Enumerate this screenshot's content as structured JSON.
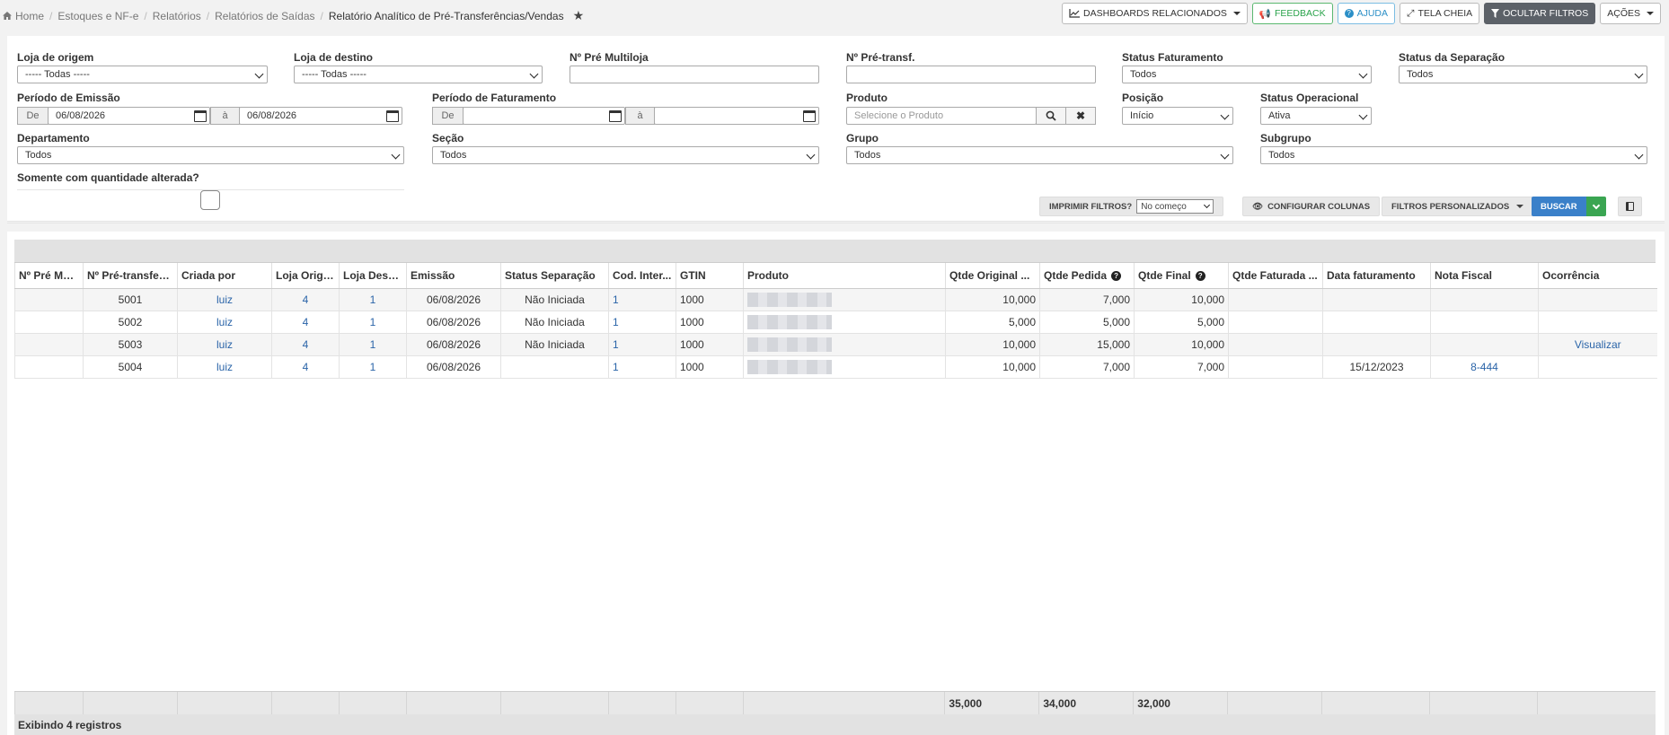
{
  "breadcrumb": {
    "items": [
      "Home",
      "Estoques e NF-e",
      "Relatórios",
      "Relatórios de Saídas"
    ],
    "current": "Relatório Analítico de Pré-Transferências/Vendas"
  },
  "header_actions": {
    "dashboards": "DASHBOARDS RELACIONADOS",
    "feedback": "FEEDBACK",
    "ajuda": "AJUDA",
    "tela_cheia": "TELA CHEIA",
    "ocultar_filtros": "OCULTAR FILTROS",
    "acoes": "AÇÕES"
  },
  "filters": {
    "loja_origem": {
      "label": "Loja de origem",
      "value": "----- Todas -----"
    },
    "loja_destino": {
      "label": "Loja de destino",
      "value": "----- Todas -----"
    },
    "pre_multiloja": {
      "label": "Nº Pré Multiloja",
      "value": ""
    },
    "pre_transf": {
      "label": "Nº Pré-transf.",
      "value": ""
    },
    "status_faturamento": {
      "label": "Status Faturamento",
      "value": "Todos"
    },
    "status_separacao": {
      "label": "Status da Separação",
      "value": "Todos"
    },
    "periodo_emissao": {
      "label": "Período de Emissão",
      "de": "De",
      "ate": "à",
      "from": "06/08/2026",
      "to": "06/08/2026"
    },
    "periodo_faturamento": {
      "label": "Período de Faturamento",
      "de": "De",
      "ate": "à",
      "from": "",
      "to": ""
    },
    "produto": {
      "label": "Produto",
      "placeholder": "Selecione o Produto"
    },
    "posicao": {
      "label": "Posição",
      "value": "Início"
    },
    "status_operacional": {
      "label": "Status Operacional",
      "value": "Ativa"
    },
    "departamento": {
      "label": "Departamento",
      "value": "Todos"
    },
    "secao": {
      "label": "Seção",
      "value": "Todos"
    },
    "grupo": {
      "label": "Grupo",
      "value": "Todos"
    },
    "subgrupo": {
      "label": "Subgrupo",
      "value": "Todos"
    },
    "somente_qtd": {
      "label": "Somente com quantidade alterada?"
    }
  },
  "toolbar": {
    "imprimir_label": "IMPRIMIR FILTROS?",
    "imprimir_value": "No começo",
    "configurar": "CONFIGURAR COLUNAS",
    "personalizados": "FILTROS PERSONALIZADOS",
    "buscar": "BUSCAR"
  },
  "table": {
    "columns": [
      "Nº Pré Mul...",
      "Nº Pré-transferê...",
      "Criada por",
      "Loja Orige...",
      "Loja Desti...",
      "Emissão",
      "Status Separação",
      "Cod. Inter...",
      "GTIN",
      "Produto",
      "Qtde Original ...",
      "Qtde Pedida",
      "Qtde Final",
      "Qtde Faturada ...",
      "Data faturamento",
      "Nota Fiscal",
      "Ocorrência"
    ],
    "rows": [
      {
        "pre_mul": "",
        "pre_transf": "5001",
        "criada": "luiz",
        "origem": "4",
        "destino": "1",
        "emissao": "06/08/2026",
        "status": "Não Iniciada",
        "cod": "1",
        "gtin": "1000",
        "orig": "10,000",
        "pedida": "7,000",
        "final": "10,000",
        "faturada": "",
        "data_fat": "",
        "nf": "",
        "ocorrencia": ""
      },
      {
        "pre_mul": "",
        "pre_transf": "5002",
        "criada": "luiz",
        "origem": "4",
        "destino": "1",
        "emissao": "06/08/2026",
        "status": "Não Iniciada",
        "cod": "1",
        "gtin": "1000",
        "orig": "5,000",
        "pedida": "5,000",
        "final": "5,000",
        "faturada": "",
        "data_fat": "",
        "nf": "",
        "ocorrencia": ""
      },
      {
        "pre_mul": "",
        "pre_transf": "5003",
        "criada": "luiz",
        "origem": "4",
        "destino": "1",
        "emissao": "06/08/2026",
        "status": "Não Iniciada",
        "cod": "1",
        "gtin": "1000",
        "orig": "10,000",
        "pedida": "15,000",
        "final": "10,000",
        "faturada": "",
        "data_fat": "",
        "nf": "",
        "ocorrencia": "Visualizar"
      },
      {
        "pre_mul": "",
        "pre_transf": "5004",
        "criada": "luiz",
        "origem": "4",
        "destino": "1",
        "emissao": "06/08/2026",
        "status": "",
        "cod": "1",
        "gtin": "1000",
        "orig": "10,000",
        "pedida": "7,000",
        "final": "7,000",
        "faturada": "",
        "data_fat": "15/12/2023",
        "nf": "8-444",
        "ocorrencia": ""
      }
    ],
    "totals": {
      "orig": "35,000",
      "pedida": "34,000",
      "final": "32,000"
    },
    "footer": "Exibindo 4 registros"
  }
}
